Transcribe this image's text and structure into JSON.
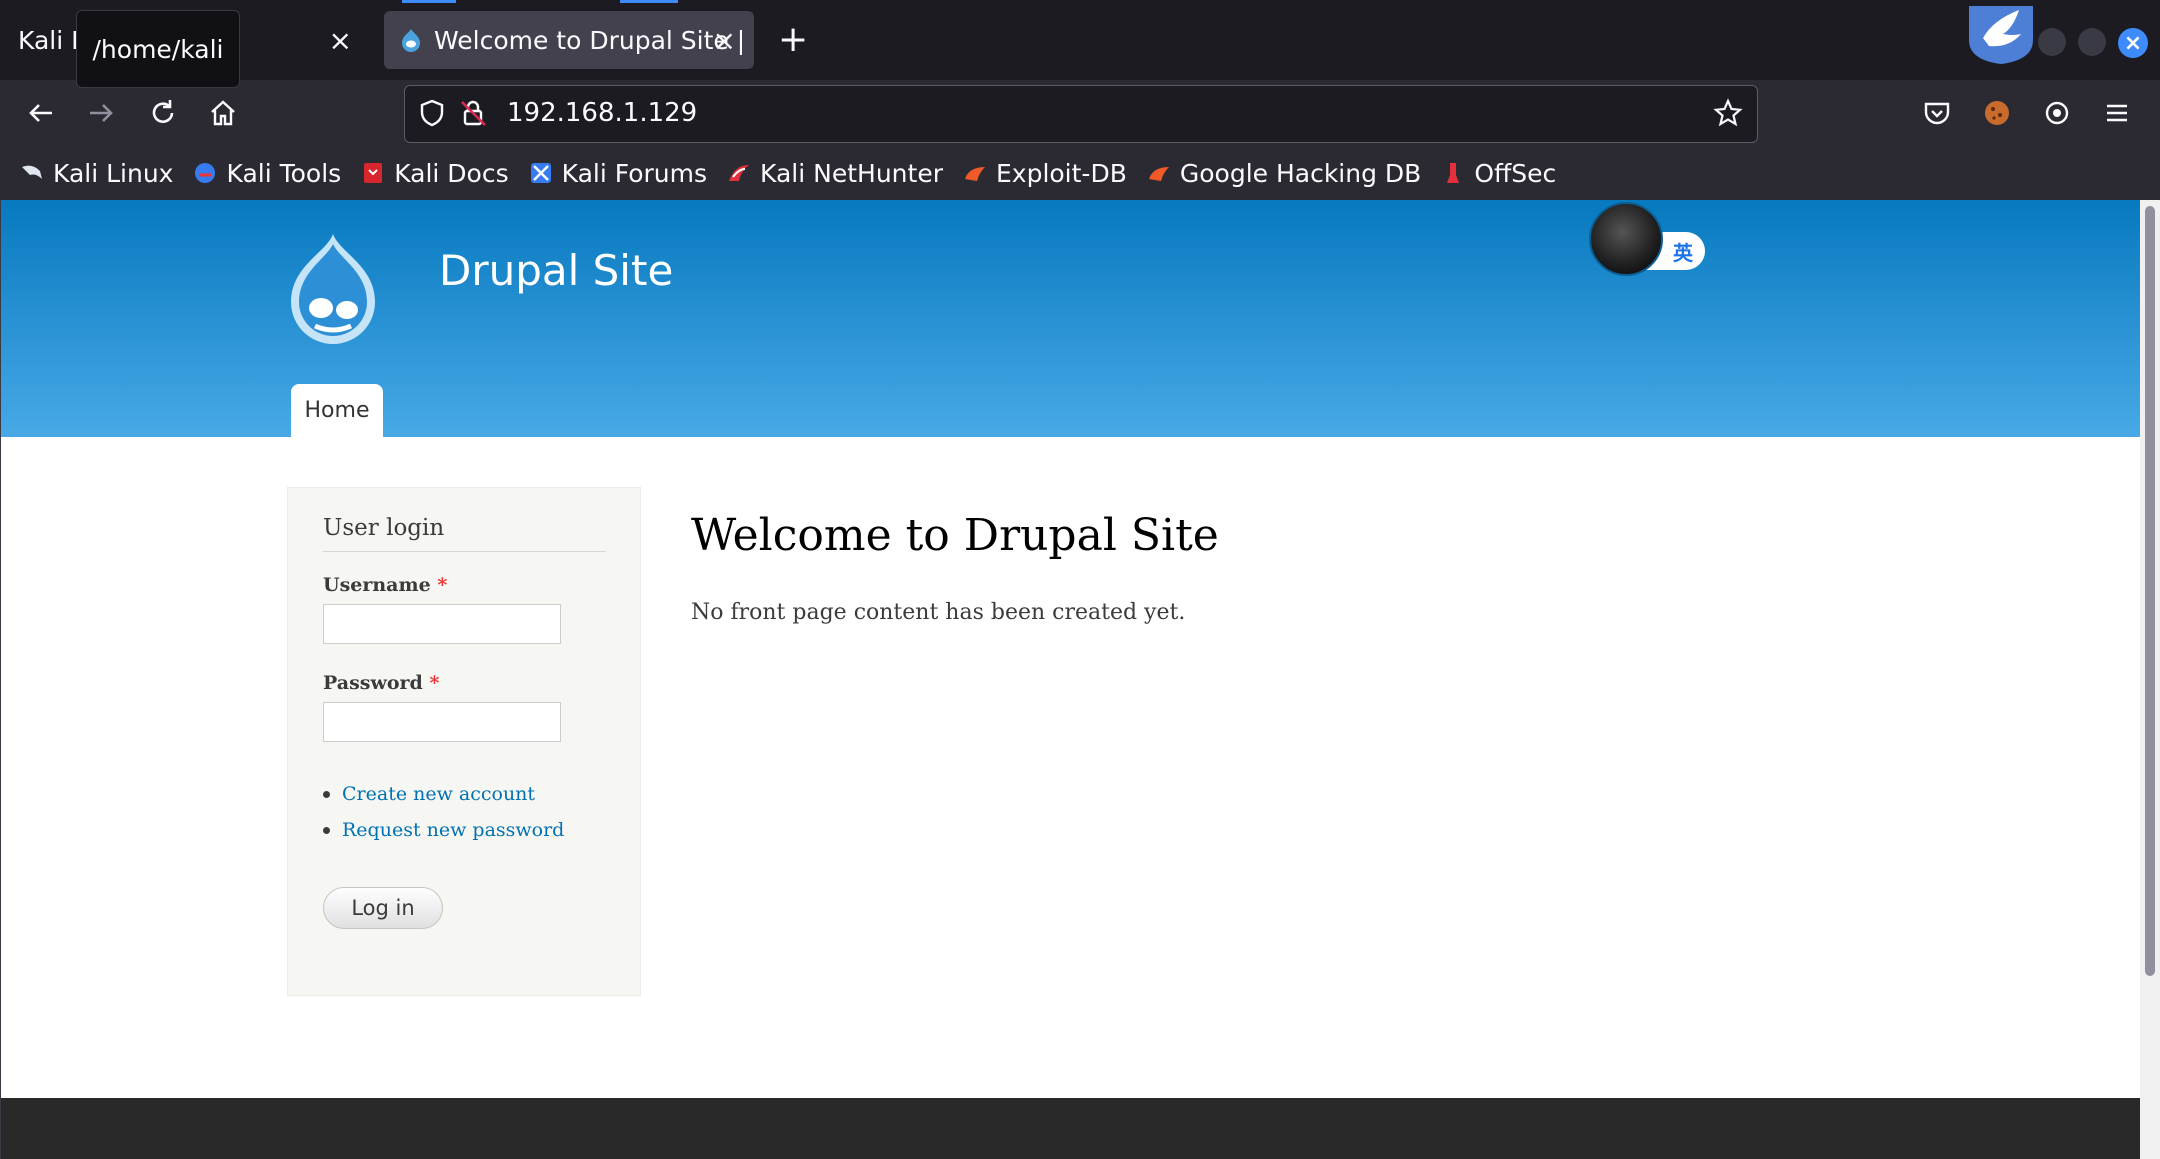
{
  "browser": {
    "tabs": [
      {
        "title": "Kali Li",
        "close": "×"
      },
      {
        "title": "Welcome to Drupal Site | ",
        "close": "×"
      }
    ],
    "tooltip": "/home/kali",
    "new_tab": "+",
    "url": "192.168.1.129",
    "window_close": "×",
    "accent_color": "#3d8bfd"
  },
  "bookmarks": [
    {
      "label": "Kali Linux",
      "icon": "kali-dragon-icon"
    },
    {
      "label": "Kali Tools",
      "icon": "kali-tools-icon"
    },
    {
      "label": "Kali Docs",
      "icon": "kali-docs-icon"
    },
    {
      "label": "Kali Forums",
      "icon": "kali-forums-icon"
    },
    {
      "label": "Kali NetHunter",
      "icon": "kali-nethunter-icon"
    },
    {
      "label": "Exploit-DB",
      "icon": "exploit-db-icon"
    },
    {
      "label": "Google Hacking DB",
      "icon": "ghdb-icon"
    },
    {
      "label": "OffSec",
      "icon": "offsec-icon"
    }
  ],
  "site": {
    "name": "Drupal Site",
    "nav_home": "Home",
    "ime_label": "英",
    "header_color": "#0779bf"
  },
  "login": {
    "title": "User login",
    "username_label": "Username",
    "password_label": "Password",
    "required_mark": "*",
    "links": [
      "Create new account",
      "Request new password"
    ],
    "submit": "Log in"
  },
  "main": {
    "title": "Welcome to Drupal Site",
    "text": "No front page content has been created yet."
  }
}
